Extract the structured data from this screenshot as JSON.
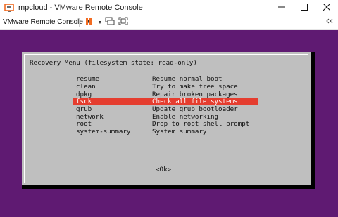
{
  "window": {
    "title": "mpcloud - VMware Remote Console",
    "minimize_icon": "minimize-icon",
    "maximize_icon": "maximize-icon",
    "close_icon": "close-icon"
  },
  "toolbar": {
    "menu_label": "VMware Remote Console",
    "pause_icon": "pause-icon",
    "devices_icon": "devices-icon",
    "fit_icon": "fit-window-icon",
    "send_keys_icon": "ctrl-alt-del-icon",
    "accent_color": "#f26b21"
  },
  "console": {
    "background_color": "#5f1a72",
    "dialog": {
      "title": "Recovery Menu (filesystem state: read-only)",
      "items": [
        {
          "key": "resume",
          "desc": "Resume normal boot"
        },
        {
          "key": "clean",
          "desc": "Try to make free space"
        },
        {
          "key": "dpkg",
          "desc": "Repair broken packages"
        },
        {
          "key": "fsck",
          "desc": "Check all file systems",
          "selected": true
        },
        {
          "key": "grub",
          "desc": "Update grub bootloader"
        },
        {
          "key": "network",
          "desc": "Enable networking"
        },
        {
          "key": "root",
          "desc": "Drop to root shell prompt"
        },
        {
          "key": "system-summary",
          "desc": "System summary"
        }
      ],
      "ok_button": "<Ok>",
      "highlight_color": "#e53d2f"
    }
  }
}
